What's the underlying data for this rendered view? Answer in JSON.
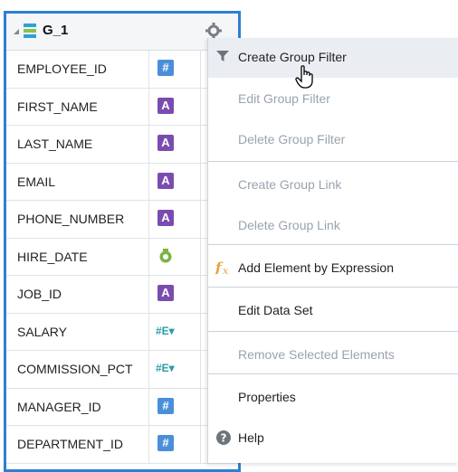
{
  "group": {
    "title": "G_1",
    "fields": [
      {
        "name": "EMPLOYEE_ID",
        "type": "number"
      },
      {
        "name": "FIRST_NAME",
        "type": "string"
      },
      {
        "name": "LAST_NAME",
        "type": "string"
      },
      {
        "name": "EMAIL",
        "type": "string"
      },
      {
        "name": "PHONE_NUMBER",
        "type": "string"
      },
      {
        "name": "HIRE_DATE",
        "type": "date"
      },
      {
        "name": "JOB_ID",
        "type": "string"
      },
      {
        "name": "SALARY",
        "type": "aggregate"
      },
      {
        "name": "COMMISSION_PCT",
        "type": "aggregate"
      },
      {
        "name": "MANAGER_ID",
        "type": "number"
      },
      {
        "name": "DEPARTMENT_ID",
        "type": "number"
      }
    ],
    "type_glyphs": {
      "number": "#",
      "string": "A",
      "aggregate_label": "#E▾"
    }
  },
  "menu": {
    "items": [
      {
        "label": "Create Group Filter",
        "enabled": true,
        "icon": "filter-icon"
      },
      {
        "label": "Edit Group Filter",
        "enabled": false
      },
      {
        "label": "Delete Group Filter",
        "enabled": false
      },
      {
        "label": "Create Group Link",
        "enabled": false
      },
      {
        "label": "Delete Group Link",
        "enabled": false
      },
      {
        "label": "Add Element by Expression",
        "enabled": true,
        "icon": "fx-icon"
      },
      {
        "label": "Edit Data Set",
        "enabled": true
      },
      {
        "label": "Remove Selected Elements",
        "enabled": false
      },
      {
        "label": "Properties",
        "enabled": true
      },
      {
        "label": "Help",
        "enabled": true,
        "icon": "help-icon"
      }
    ]
  },
  "colors": {
    "panel_border": "#2d7fd3",
    "number_type": "#4a8fd9",
    "string_type": "#7a4cb0",
    "disabled_text": "#9aa3ad"
  }
}
